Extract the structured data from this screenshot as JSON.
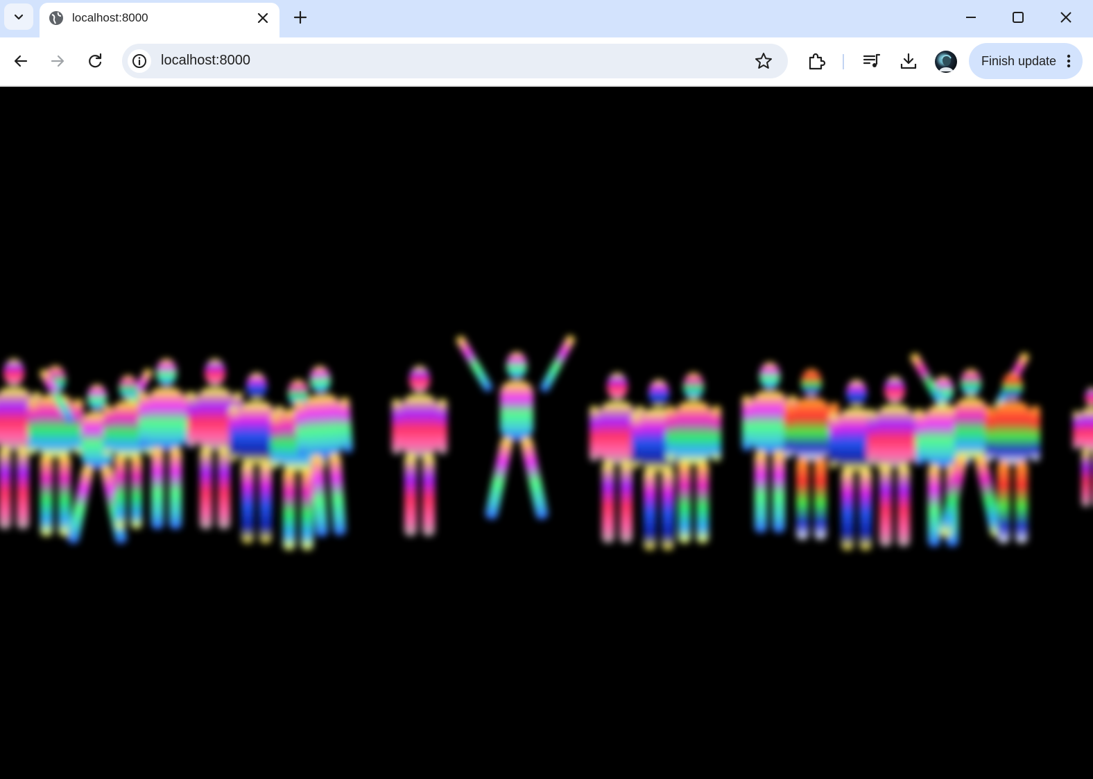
{
  "browser": {
    "tab": {
      "title": "localhost:8000"
    },
    "address_bar": {
      "url": "localhost:8000"
    },
    "update_button": {
      "label": "Finish update"
    }
  },
  "icons": {
    "tab_search": "chevron-down-icon",
    "favicon": "globe-icon",
    "tab_close": "close-icon",
    "new_tab": "plus-icon",
    "minimize": "minimize-icon",
    "maximize": "maximize-icon",
    "close_window": "close-icon",
    "back": "back-arrow-icon",
    "forward": "forward-arrow-icon",
    "reload": "reload-icon",
    "site_info": "info-icon",
    "bookmark": "star-icon",
    "extensions": "puzzle-icon",
    "media_controls": "media-queue-icon",
    "downloads": "download-icon",
    "profile": "avatar",
    "menu": "kebab-menu-icon"
  },
  "colors": {
    "tabstrip_bg": "#d3e3fd",
    "omnibox_bg": "#e9eef6",
    "page_bg": "#000000"
  }
}
